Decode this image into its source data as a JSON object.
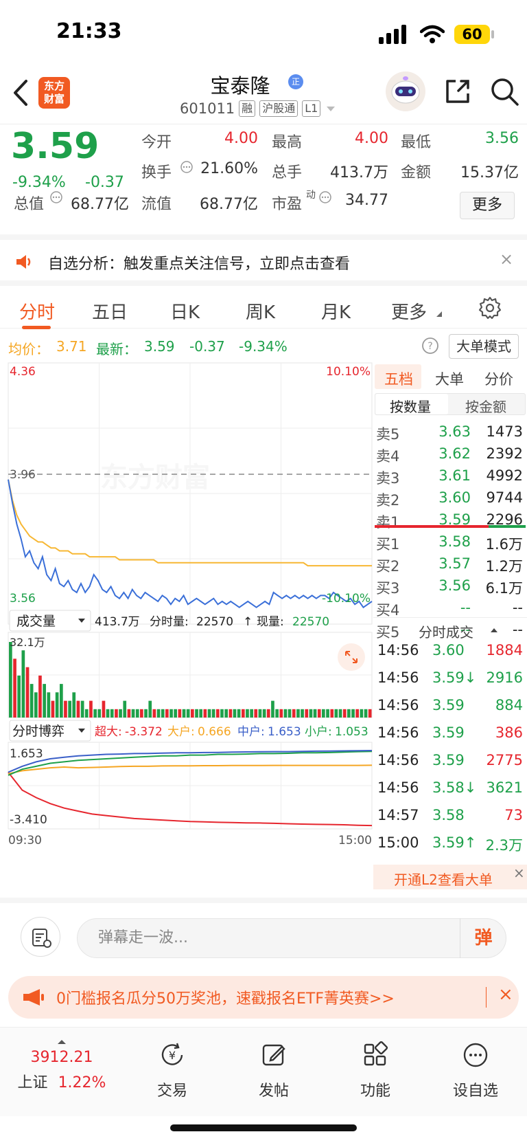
{
  "status": {
    "time": "21:33",
    "battery": "60"
  },
  "header": {
    "logo_line1": "东方",
    "logo_line2": "财富",
    "name": "宝泰隆",
    "name_badge": "正",
    "code": "601011",
    "tags": [
      "融",
      "沪股通",
      "L1"
    ]
  },
  "quote": {
    "price": "3.59",
    "pct": "-9.34%",
    "chg": "-0.37",
    "fields": [
      {
        "label": "今开",
        "value": "4.00",
        "color": "red"
      },
      {
        "label": "最高",
        "value": "4.00",
        "color": "red"
      },
      {
        "label": "最低",
        "value": "3.56",
        "color": "green"
      },
      {
        "label": "换手",
        "value": "21.60%",
        "color": "dark"
      },
      {
        "label": "总手",
        "value": "413.7万",
        "color": "dark"
      },
      {
        "label": "金额",
        "value": "15.37亿",
        "color": "dark"
      },
      {
        "label": "总值",
        "value": "68.77亿",
        "color": "dark"
      },
      {
        "label": "流值",
        "value": "68.77亿",
        "color": "dark"
      },
      {
        "label": "市盈",
        "value": "34.77",
        "color": "dark"
      }
    ],
    "pe_sup": "动",
    "more": "更多"
  },
  "notice": {
    "text": "自选分析：触发重点关注信号，立即点击查看",
    "close": "×"
  },
  "tabs": [
    "分时",
    "五日",
    "日K",
    "周K",
    "月K",
    "更多"
  ],
  "infoline": {
    "avg_label": "均价：",
    "avg_value": "3.71",
    "latest_label": "最新：",
    "latest_value": "3.59",
    "latest_chg": "-0.37",
    "latest_pct": "-9.34%",
    "bigorder": "大单模式"
  },
  "chart_data": {
    "type": "line",
    "title": "",
    "price_axis": {
      "top": "4.36",
      "mid": "3.96",
      "bottom": "3.56"
    },
    "pct_axis": {
      "top": "10.10%",
      "bottom": "-10.10%"
    },
    "xlabels": [
      "09:30",
      "15:00"
    ],
    "watermark": "东方财富",
    "ylim": [
      3.56,
      4.36
    ],
    "prev_close": 3.96,
    "series": [
      {
        "name": "最新",
        "color": "#3a6fd8",
        "values": [
          4.0,
          3.92,
          3.85,
          3.8,
          3.74,
          3.76,
          3.72,
          3.7,
          3.74,
          3.68,
          3.66,
          3.7,
          3.65,
          3.64,
          3.66,
          3.63,
          3.62,
          3.65,
          3.62,
          3.64,
          3.68,
          3.66,
          3.63,
          3.62,
          3.64,
          3.61,
          3.6,
          3.62,
          3.6,
          3.63,
          3.61,
          3.6,
          3.62,
          3.61,
          3.6,
          3.59,
          3.61,
          3.6,
          3.58,
          3.6,
          3.59,
          3.61,
          3.58,
          3.59,
          3.6,
          3.59,
          3.58,
          3.59,
          3.6,
          3.58,
          3.59,
          3.58,
          3.59,
          3.58,
          3.57,
          3.58,
          3.59,
          3.58,
          3.57,
          3.58,
          3.59,
          3.58,
          3.62,
          3.61,
          3.6,
          3.61,
          3.6,
          3.61,
          3.6,
          3.61,
          3.6,
          3.61,
          3.6,
          3.61,
          3.61,
          3.6,
          3.62,
          3.61,
          3.6,
          3.59,
          3.6,
          3.58,
          3.59,
          3.57,
          3.58,
          3.59
        ]
      },
      {
        "name": "均价",
        "color": "#f7b733",
        "values": [
          4.0,
          3.93,
          3.88,
          3.85,
          3.83,
          3.81,
          3.8,
          3.79,
          3.79,
          3.78,
          3.77,
          3.77,
          3.76,
          3.76,
          3.76,
          3.75,
          3.75,
          3.75,
          3.75,
          3.74,
          3.74,
          3.74,
          3.74,
          3.74,
          3.74,
          3.74,
          3.73,
          3.73,
          3.73,
          3.73,
          3.73,
          3.73,
          3.73,
          3.73,
          3.73,
          3.72,
          3.72,
          3.72,
          3.72,
          3.72,
          3.72,
          3.72,
          3.72,
          3.72,
          3.72,
          3.72,
          3.72,
          3.72,
          3.72,
          3.72,
          3.72,
          3.72,
          3.72,
          3.72,
          3.72,
          3.72,
          3.72,
          3.72,
          3.72,
          3.72,
          3.72,
          3.72,
          3.72,
          3.72,
          3.72,
          3.72,
          3.72,
          3.72,
          3.72,
          3.72,
          3.71,
          3.71,
          3.71,
          3.71,
          3.71,
          3.71,
          3.71,
          3.71,
          3.71,
          3.71,
          3.71,
          3.71,
          3.71,
          3.71,
          3.71,
          3.71
        ]
      }
    ]
  },
  "volume": {
    "selector": "成交量",
    "summary_total": "413.7万",
    "summary_label": "分时量:",
    "summary_value": "22570",
    "summary_arrow": "↑",
    "now_label": "现量:",
    "now_value": "22570",
    "axis_top": "32.1万",
    "bars": [
      9,
      7,
      5,
      8,
      6,
      4,
      3,
      5,
      4,
      3,
      2,
      3,
      4,
      2,
      2,
      3,
      2,
      2,
      1,
      2,
      1,
      1,
      2,
      1,
      1,
      1,
      1,
      2,
      1,
      1,
      1,
      1,
      1,
      2,
      1,
      1,
      1,
      1,
      1,
      1,
      1,
      1,
      1,
      1,
      1,
      1,
      1,
      1,
      1,
      1,
      1,
      1,
      1,
      1,
      1,
      1,
      1,
      1,
      1,
      1,
      1,
      1,
      2,
      1,
      1,
      1,
      1,
      1,
      1,
      1,
      1,
      1,
      1,
      1,
      1,
      1,
      1,
      1,
      1,
      1,
      1,
      1,
      1,
      1,
      1,
      1
    ]
  },
  "game": {
    "selector": "分时博弈",
    "super_label": "超大:",
    "super_value": "-3.372",
    "big_label": "大户:",
    "big_value": "0.666",
    "mid_label": "中户:",
    "mid_value": "1.653",
    "small_label": "小户:",
    "small_value": "1.053",
    "axis_top": "1.653",
    "axis_bottom": "-3.410",
    "ylim": [
      -3.41,
      1.653
    ],
    "series": [
      {
        "name": "超大",
        "color": "#e6262e",
        "values": [
          0.2,
          -1.0,
          -1.5,
          -1.9,
          -2.2,
          -2.4,
          -2.6,
          -2.7,
          -2.8,
          -2.9,
          -2.95,
          -3.0,
          -3.05,
          -3.1,
          -3.12,
          -3.15,
          -3.17,
          -3.19,
          -3.2,
          -3.22,
          -3.25,
          -3.27,
          -3.29,
          -3.3,
          -3.32,
          -3.35,
          -3.37
        ]
      },
      {
        "name": "大户",
        "color": "#f5a623",
        "values": [
          0.1,
          0.3,
          0.4,
          0.5,
          0.55,
          0.5,
          0.52,
          0.55,
          0.58,
          0.6,
          0.6,
          0.62,
          0.63,
          0.63,
          0.64,
          0.64,
          0.65,
          0.65,
          0.65,
          0.66,
          0.66,
          0.66,
          0.66,
          0.66,
          0.66,
          0.66,
          0.666
        ]
      },
      {
        "name": "中户",
        "color": "#1ea04a",
        "values": [
          0.0,
          0.4,
          0.6,
          0.8,
          0.9,
          1.0,
          1.05,
          1.1,
          1.15,
          1.2,
          1.25,
          1.3,
          1.3,
          1.35,
          1.35,
          1.4,
          1.4,
          1.42,
          1.45,
          1.45,
          1.47,
          1.5,
          1.5,
          1.52,
          1.55,
          1.58,
          1.6
        ]
      },
      {
        "name": "小户",
        "color": "#3a5fc8",
        "values": [
          0.2,
          0.6,
          0.9,
          1.1,
          1.2,
          1.3,
          1.35,
          1.4,
          1.42,
          1.45,
          1.46,
          1.48,
          1.5,
          1.5,
          1.52,
          1.53,
          1.55,
          1.56,
          1.57,
          1.58,
          1.58,
          1.6,
          1.61,
          1.62,
          1.63,
          1.64,
          1.653
        ]
      }
    ],
    "xlabels": [
      "09:30",
      "15:00"
    ]
  },
  "panel": {
    "tabs": [
      "五档",
      "大单",
      "分价"
    ],
    "subtabs": [
      "按数量",
      "按金额"
    ],
    "asks": [
      {
        "label": "卖5",
        "price": "3.63",
        "vol": "1473"
      },
      {
        "label": "卖4",
        "price": "3.62",
        "vol": "2392"
      },
      {
        "label": "卖3",
        "price": "3.61",
        "vol": "4992"
      },
      {
        "label": "卖2",
        "price": "3.60",
        "vol": "9744"
      },
      {
        "label": "卖1",
        "price": "3.59",
        "vol": "2296"
      }
    ],
    "bids": [
      {
        "label": "买1",
        "price": "3.58",
        "vol": "1.6万"
      },
      {
        "label": "买2",
        "price": "3.57",
        "vol": "1.2万"
      },
      {
        "label": "买3",
        "price": "3.56",
        "vol": "6.1万"
      },
      {
        "label": "买4",
        "price": "--",
        "vol": "--"
      },
      {
        "label": "买5",
        "price": "--",
        "vol": "--"
      }
    ],
    "ticks_title": "分时成交",
    "ticks": [
      {
        "time": "14:56",
        "price": "3.60",
        "vol": "1884",
        "vc": "red"
      },
      {
        "time": "14:56",
        "price": "3.59↓",
        "vol": "2916",
        "vc": "green"
      },
      {
        "time": "14:56",
        "price": "3.59",
        "vol": "884",
        "vc": "green"
      },
      {
        "time": "14:56",
        "price": "3.59",
        "vol": "386",
        "vc": "red"
      },
      {
        "time": "14:56",
        "price": "3.59",
        "vol": "2775",
        "vc": "red"
      },
      {
        "time": "14:56",
        "price": "3.58↓",
        "vol": "3621",
        "vc": "green"
      },
      {
        "time": "14:57",
        "price": "3.58",
        "vol": "73",
        "vc": "red"
      },
      {
        "time": "15:00",
        "price": "3.59↑",
        "vol": "2.3万",
        "vc": "green"
      }
    ],
    "l2": "开通L2查看大单",
    "l2_close": "×"
  },
  "comment": {
    "placeholder": "弹幕走一波...",
    "danmu": "弹"
  },
  "promo": {
    "text": "0门槛报名瓜分50万奖池，速戳报名ETF菁英赛>>",
    "close": "×"
  },
  "nav": {
    "index_value": "3912.21",
    "index_name": "上证",
    "index_pct": "1.22%",
    "items": [
      "交易",
      "发帖",
      "功能",
      "设自选"
    ]
  },
  "colors": {
    "accent": "#f15a22",
    "up": "#e6262e",
    "down": "#1ea04a",
    "avg": "#f7b733",
    "price": "#3a6fd8"
  }
}
